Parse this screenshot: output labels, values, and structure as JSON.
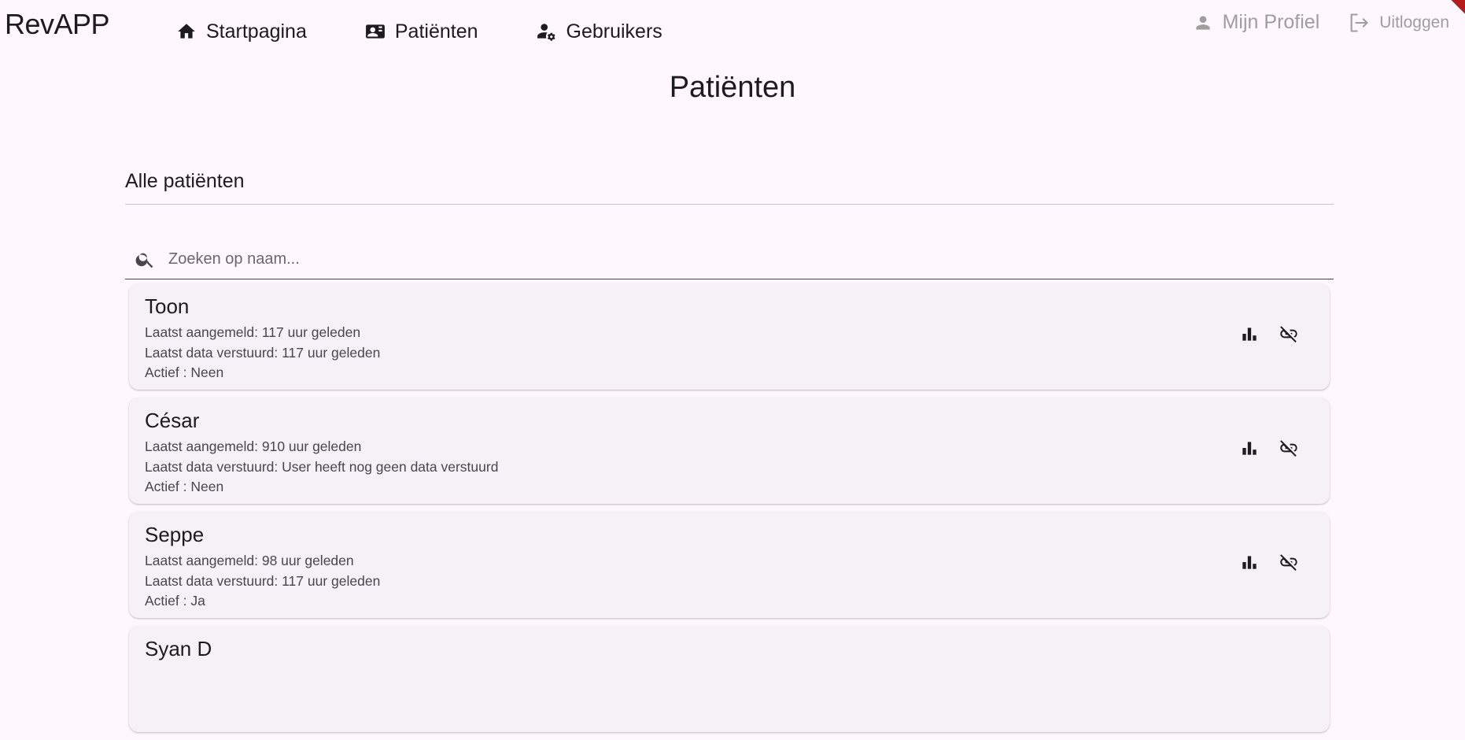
{
  "header": {
    "brand": "RevAPP",
    "nav": [
      {
        "label": "Startpagina",
        "icon": "home-icon"
      },
      {
        "label": "Patiënten",
        "icon": "contact-card-icon"
      },
      {
        "label": "Gebruikers",
        "icon": "user-gear-icon"
      }
    ],
    "profile_label": "Mijn Profiel",
    "logout_label": "Uitloggen"
  },
  "page": {
    "title": "Patiënten",
    "section_title": "Alle patiënten",
    "search": {
      "placeholder": "Zoeken op naam...",
      "value": ""
    }
  },
  "patients": [
    {
      "name": "Toon",
      "last_login": "Laatst aangemeld: 117 uur geleden",
      "last_data": "Laatst data verstuurd: 117 uur geleden",
      "active": "Actief : Neen"
    },
    {
      "name": "César",
      "last_login": "Laatst aangemeld: 910 uur geleden",
      "last_data": "Laatst data verstuurd: User heeft nog geen data verstuurd",
      "active": "Actief : Neen"
    },
    {
      "name": "Seppe",
      "last_login": "Laatst aangemeld: 98 uur geleden",
      "last_data": "Laatst data verstuurd: 117 uur geleden",
      "active": "Actief : Ja"
    },
    {
      "name": "Syan D",
      "last_login": "",
      "last_data": "",
      "active": ""
    }
  ],
  "colors": {
    "background": "#fef7fe",
    "card": "#f5f1f7",
    "text": "#1d1b20",
    "muted": "#9e9e9e",
    "ribbon": "#b71c1c"
  }
}
